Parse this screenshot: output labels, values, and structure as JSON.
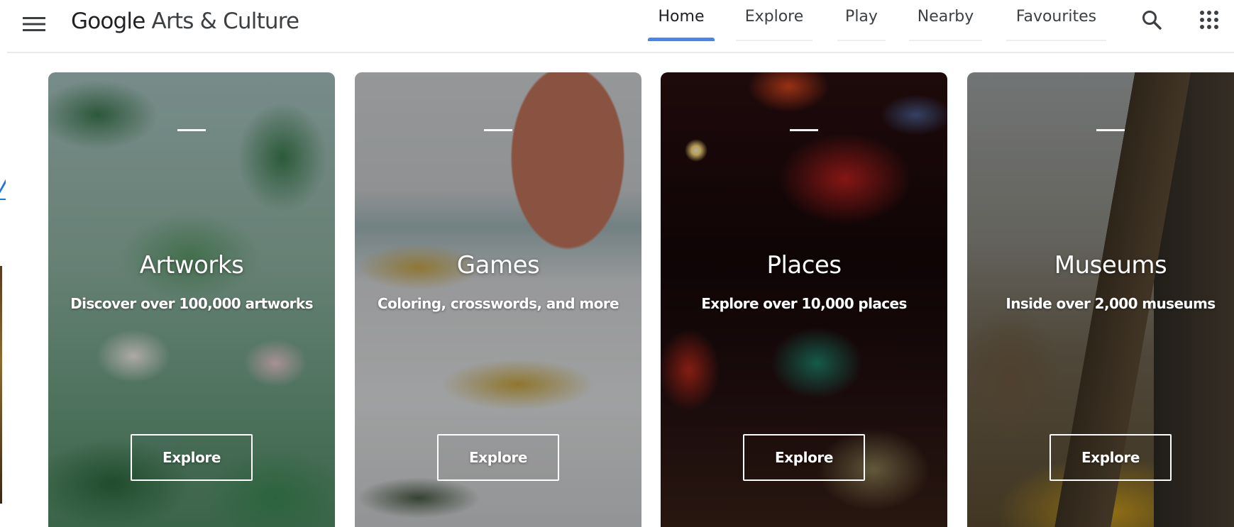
{
  "header": {
    "logo": {
      "brand": "Google",
      "product": "Arts & Culture"
    },
    "menu_icon": "hamburger-menu-icon",
    "tabs": [
      {
        "label": "Home",
        "active": true
      },
      {
        "label": "Explore",
        "active": false
      },
      {
        "label": "Play",
        "active": false
      },
      {
        "label": "Nearby",
        "active": false
      },
      {
        "label": "Favourites",
        "active": false
      }
    ],
    "search_icon": "search-icon",
    "apps_icon": "apps-grid-icon"
  },
  "left_column": {
    "link_fragment": "y"
  },
  "cards": [
    {
      "title": "Artworks",
      "subtitle": "Discover over 100,000 artworks",
      "button": "Explore"
    },
    {
      "title": "Games",
      "subtitle": "Coloring, crosswords, and more",
      "button": "Explore"
    },
    {
      "title": "Places",
      "subtitle": "Explore over 10,000 places",
      "button": "Explore"
    },
    {
      "title": "Museums",
      "subtitle": "Inside over 2,000 museums",
      "button": "Explore"
    }
  ],
  "colors": {
    "active_tab_indicator": "#4285f4",
    "link": "#1a73e8",
    "text_primary": "#202124",
    "text_secondary": "#3c4043"
  }
}
